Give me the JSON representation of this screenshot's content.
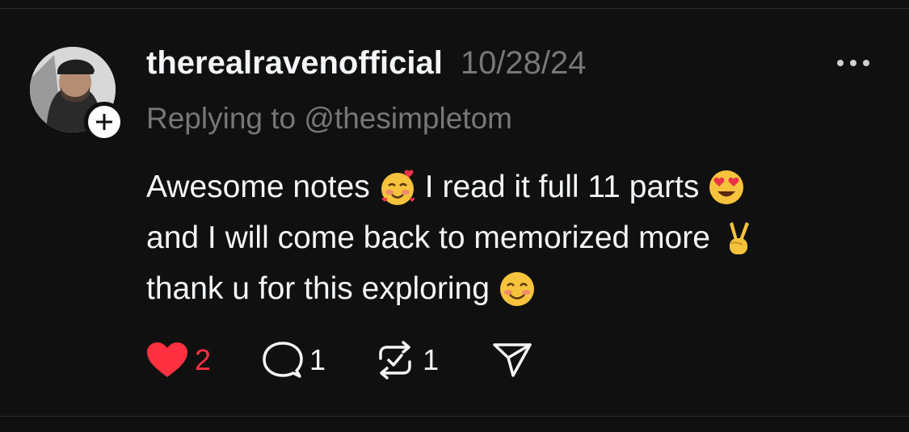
{
  "post": {
    "username": "therealravenofficial",
    "date": "10/28/24",
    "replying_to": "Replying to @thesimpletom",
    "lines": [
      {
        "before": "Awesome notes",
        "emoji": "smiling-face-with-hearts",
        "after": "I read it full 11 parts",
        "emoji2": "heart-eyes"
      },
      {
        "before": "and I will come back to memorized more",
        "emoji": "victory-hand"
      },
      {
        "before": "thank u for this exploring",
        "emoji": "smiling-face-blush"
      }
    ]
  },
  "actions": {
    "likes": "2",
    "comments": "1",
    "reposts": "1"
  },
  "icons": {
    "like": "heart-icon",
    "comment": "speech-bubble-icon",
    "repost": "repost-icon",
    "share": "send-icon",
    "more": "more-dots-icon",
    "follow": "plus-icon"
  },
  "colors": {
    "background": "#101010",
    "text": "#f3f5f7",
    "muted": "#777777",
    "like": "#ff3040"
  }
}
